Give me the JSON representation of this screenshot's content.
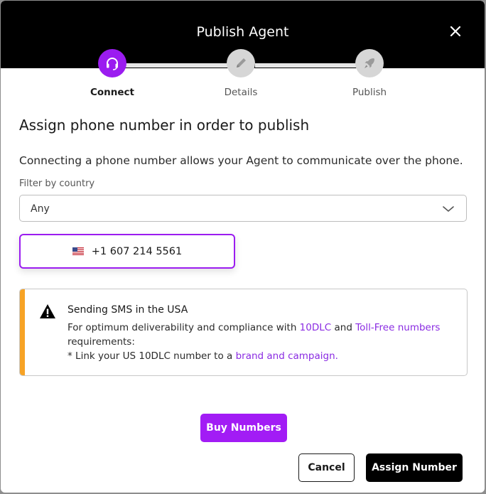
{
  "dialog": {
    "title": "Publish Agent",
    "close_icon": "close-icon"
  },
  "stepper": {
    "steps": [
      {
        "label": "Connect",
        "icon": "headset-icon",
        "state": "active"
      },
      {
        "label": "Details",
        "icon": "pencil-icon",
        "state": "inactive"
      },
      {
        "label": "Publish",
        "icon": "rocket-icon",
        "state": "inactive"
      }
    ],
    "active_color": "#9b1cf0",
    "inactive_color": "#d6d6d6"
  },
  "content": {
    "heading": "Assign phone number in order to publish",
    "description": "Connecting a phone number allows your Agent to communicate over the phone."
  },
  "filter": {
    "label": "Filter by country",
    "value": "Any",
    "chevron_icon": "chevron-down-icon"
  },
  "phone_option": {
    "flag_icon": "us-flag-icon",
    "number": "+1 607 214 5561"
  },
  "alert": {
    "icon": "warning-icon",
    "title": "Sending SMS in the USA",
    "line1_prefix": "For optimum deliverability and compliance with ",
    "link_10dlc": "10DLC",
    "line1_and": " and ",
    "link_tollfree": "Toll-Free numbers",
    "line2": "requirements:",
    "line3_prefix": "* Link your US 10DLC number to a ",
    "link_brand": "brand and campaign.",
    "accent_color": "#f7a325"
  },
  "actions": {
    "buy_label": "Buy Numbers",
    "cancel_label": "Cancel",
    "assign_label": "Assign Number"
  },
  "colors": {
    "brand_purple": "#a21cf5",
    "header_bg": "#000000"
  }
}
